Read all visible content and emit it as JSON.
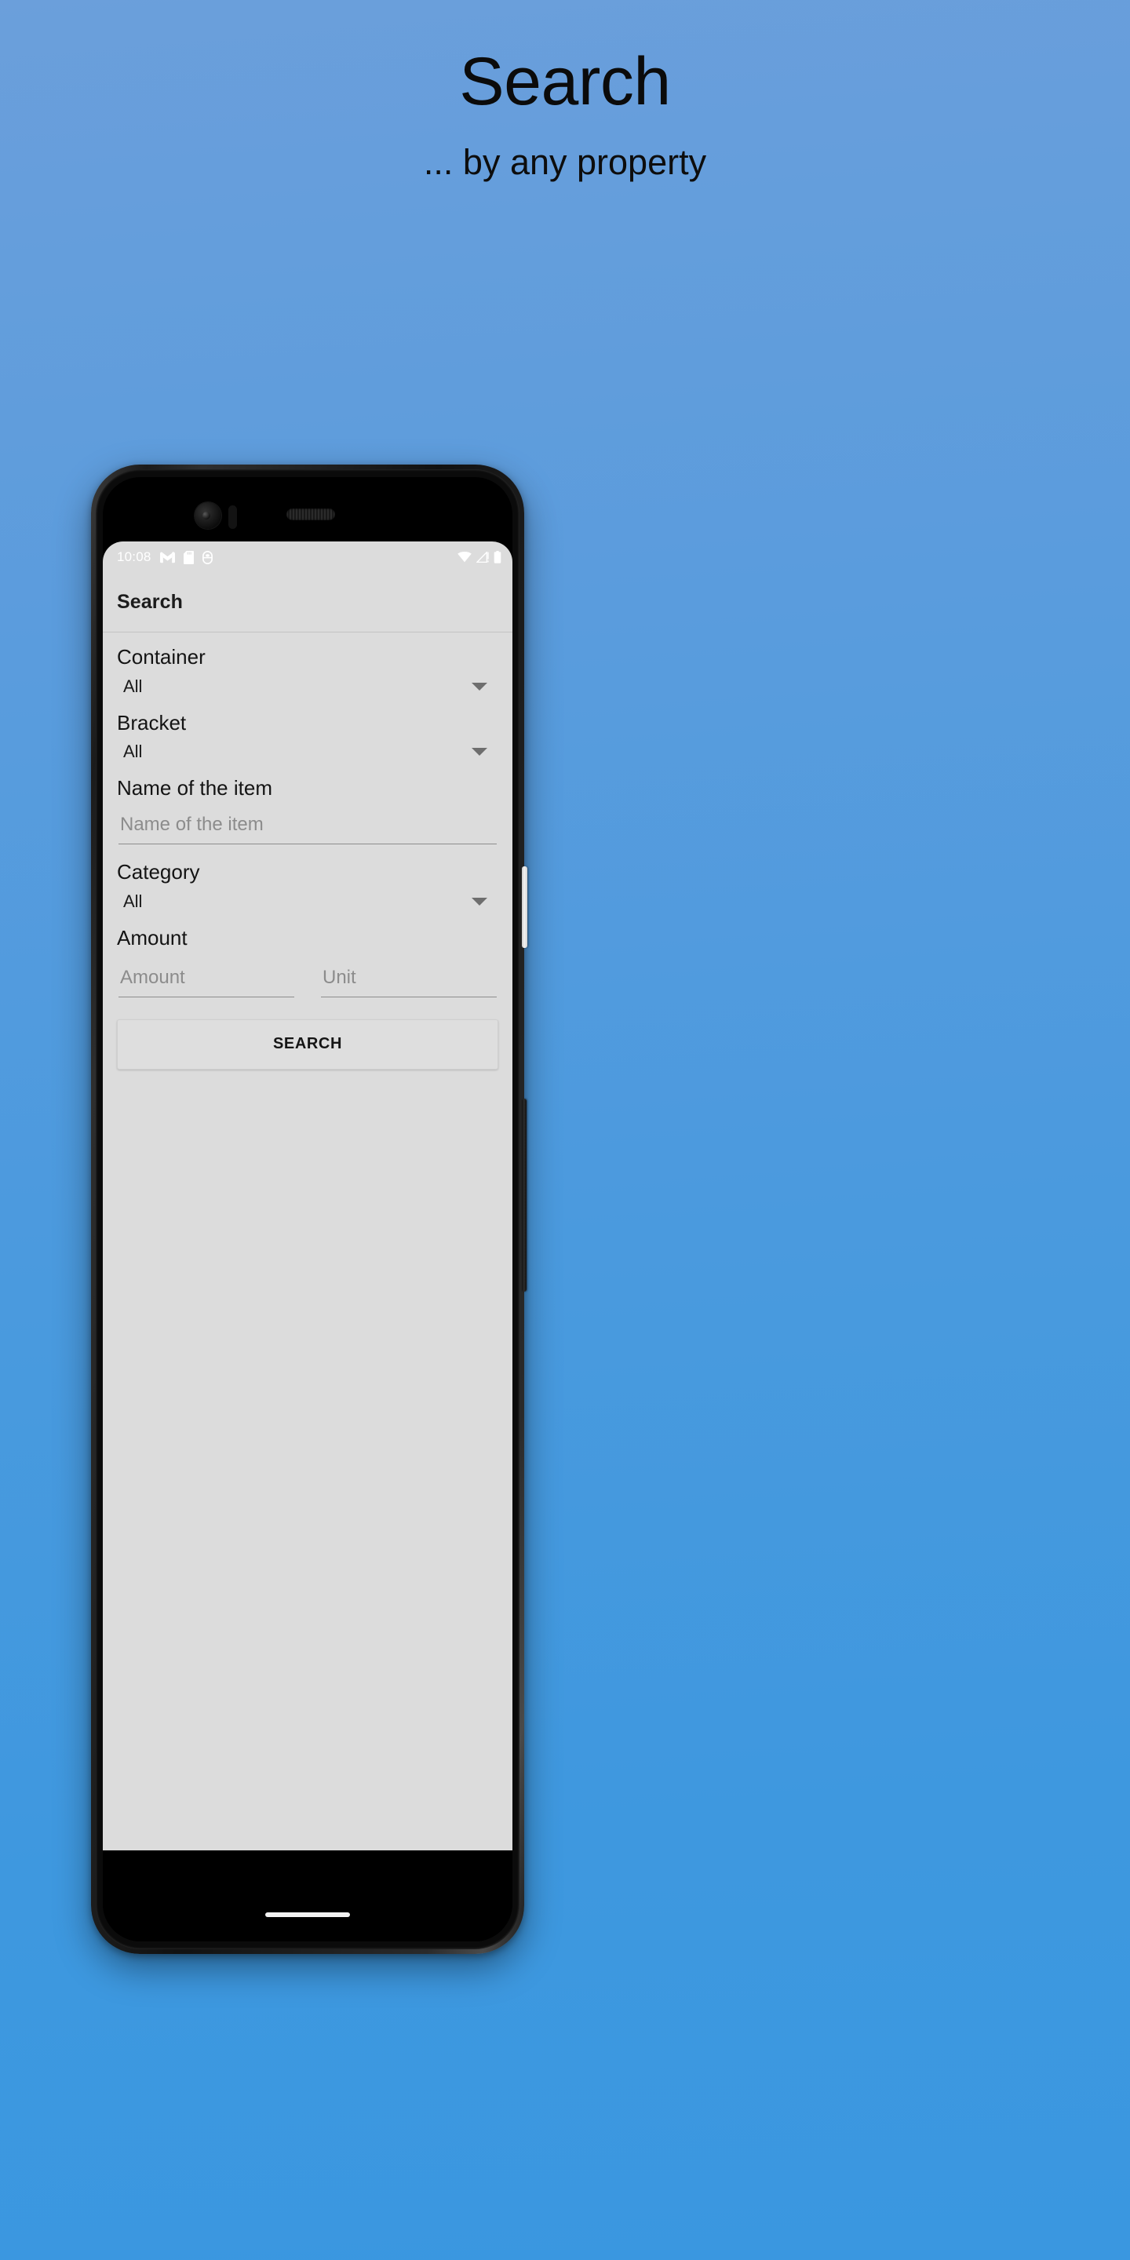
{
  "headline": {
    "title": "Search",
    "subtitle": "... by any property"
  },
  "colors": {
    "background_top": "#6b9fdb",
    "background_bottom": "#3a97e0",
    "screen_background": "#dcdcdc",
    "text_primary": "#141414",
    "text_hint": "#8c8c8c",
    "caret": "#6e6e6e"
  },
  "phone": {
    "statusbar": {
      "clock": "10:08",
      "left_icons": [
        "gmail-icon",
        "sd-card-icon",
        "usb-mouse-icon"
      ],
      "right_icons": [
        "wifi-icon",
        "cellular-signal-icon",
        "battery-icon"
      ]
    },
    "appbar": {
      "title": "Search"
    },
    "form": {
      "fields": [
        {
          "id": "container",
          "type": "spinner",
          "label": "Container",
          "value": "All"
        },
        {
          "id": "bracket",
          "type": "spinner",
          "label": "Bracket",
          "value": "All"
        },
        {
          "id": "item-name",
          "type": "text",
          "label": "Name of the item",
          "value": "",
          "placeholder": "Name of the item"
        },
        {
          "id": "category",
          "type": "spinner",
          "label": "Category",
          "value": "All"
        },
        {
          "id": "amount",
          "type": "text-pair",
          "label": "Amount",
          "amount_value": "",
          "amount_placeholder": "Amount",
          "unit_value": "",
          "unit_placeholder": "Unit"
        }
      ],
      "submit_label": "SEARCH"
    },
    "hardware": {
      "power_button": "power-button",
      "volume_button": "volume-rocker",
      "nav_gesture": "home-gesture-pill"
    }
  }
}
